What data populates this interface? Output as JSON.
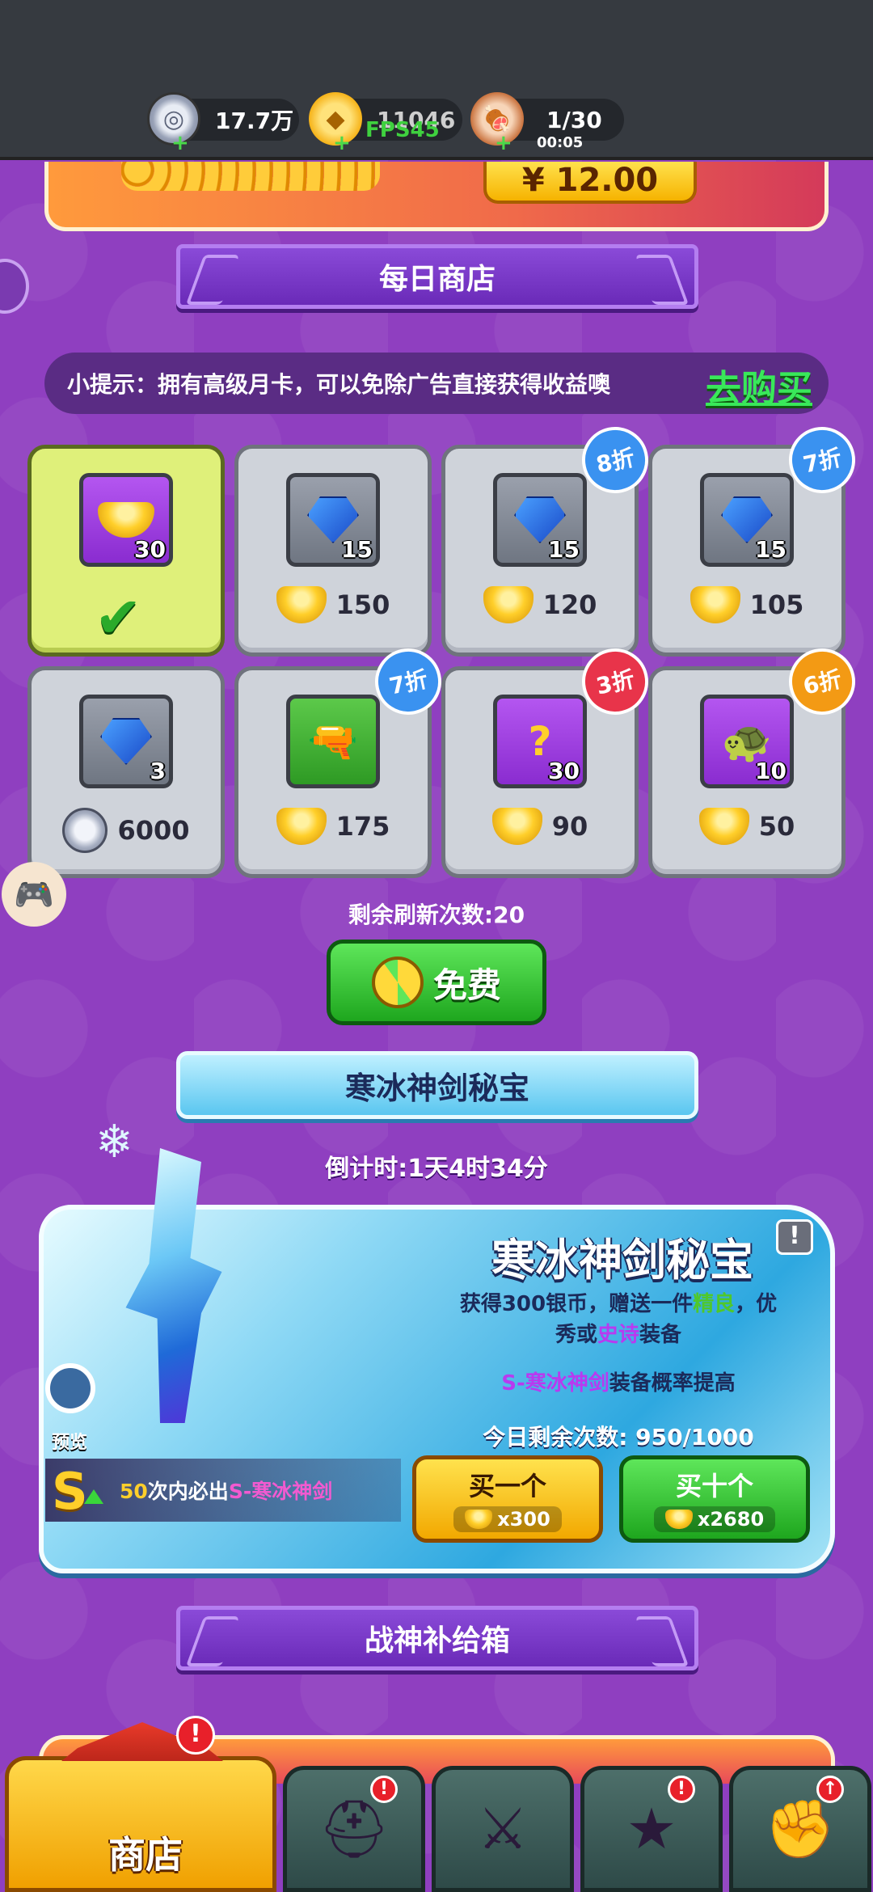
{
  "status": {
    "silver": "17.7万",
    "gold": "11046",
    "stamina": "1/30",
    "stamina_timer": "00:05",
    "fps": "FPS45"
  },
  "top_offer": {
    "price": "¥ 12.00"
  },
  "daily_shop": {
    "title": "每日商店",
    "tip": "小提示：拥有高级月卡，可以免除广告直接获得收益噢",
    "tip_link": "去购买",
    "items": [
      {
        "qty": "30",
        "icon": "gold-ingot-icon",
        "currency": "",
        "price": "",
        "discount": "",
        "purchased": true
      },
      {
        "qty": "15",
        "icon": "blue-gem-medal-icon",
        "currency": "gold",
        "price": "150",
        "discount": ""
      },
      {
        "qty": "15",
        "icon": "blue-gem-armor-icon",
        "currency": "gold",
        "price": "120",
        "discount": "8折"
      },
      {
        "qty": "15",
        "icon": "blue-gem-boot-icon",
        "currency": "gold",
        "price": "105",
        "discount": "7折"
      },
      {
        "qty": "3",
        "icon": "blue-gem-shield-icon",
        "currency": "silver",
        "price": "6000",
        "discount": ""
      },
      {
        "qty": "",
        "icon": "golden-gun-icon",
        "currency": "gold",
        "price": "175",
        "discount": "7折"
      },
      {
        "qty": "30",
        "icon": "mystery-box-icon",
        "currency": "gold",
        "price": "90",
        "discount": "3折"
      },
      {
        "qty": "10",
        "icon": "jade-tortoise-icon",
        "currency": "gold",
        "price": "50",
        "discount": "6折"
      }
    ],
    "refresh_left": "剩余刷新次数:20",
    "free_label": "免费"
  },
  "treasure": {
    "header": "寒冰神剑秘宝",
    "countdown": "倒计时:1天4时34分",
    "title": "寒冰神剑秘宝",
    "desc_a": "获得300银币，赠送一件",
    "desc_good": "精良",
    "desc_b": "，优",
    "desc_c": "秀或",
    "desc_epic": "史诗",
    "desc_d": "装备",
    "prob_name": "S-寒冰神剑",
    "prob_rest": "装备概率提高",
    "remain": "今日剩余次数: 950/1000",
    "preview": "预览",
    "guar_num": "50",
    "guar_mid": "次内必出",
    "guar_item": "S-寒冰神剑",
    "buy1_label": "买一个",
    "buy1_cost": "x300",
    "buy10_label": "买十个",
    "buy10_cost": "x2680"
  },
  "supply": {
    "title": "战神补给箱"
  },
  "nav": {
    "shop": "商店"
  },
  "colors": {
    "accent_purple": "#8f3fc0",
    "gold": "#f6b300",
    "green": "#1ea61e"
  }
}
